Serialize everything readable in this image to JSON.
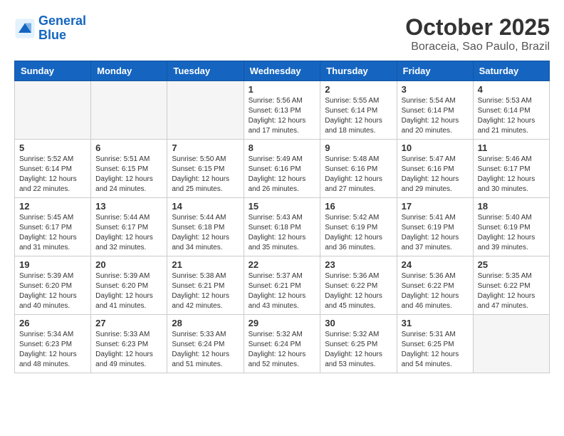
{
  "header": {
    "logo_line1": "General",
    "logo_line2": "Blue",
    "month_year": "October 2025",
    "location": "Boraceia, Sao Paulo, Brazil"
  },
  "weekdays": [
    "Sunday",
    "Monday",
    "Tuesday",
    "Wednesday",
    "Thursday",
    "Friday",
    "Saturday"
  ],
  "weeks": [
    [
      {
        "day": "",
        "empty": true
      },
      {
        "day": "",
        "empty": true
      },
      {
        "day": "",
        "empty": true
      },
      {
        "day": "1",
        "sunrise": "5:56 AM",
        "sunset": "6:13 PM",
        "daylight": "12 hours and 17 minutes."
      },
      {
        "day": "2",
        "sunrise": "5:55 AM",
        "sunset": "6:14 PM",
        "daylight": "12 hours and 18 minutes."
      },
      {
        "day": "3",
        "sunrise": "5:54 AM",
        "sunset": "6:14 PM",
        "daylight": "12 hours and 20 minutes."
      },
      {
        "day": "4",
        "sunrise": "5:53 AM",
        "sunset": "6:14 PM",
        "daylight": "12 hours and 21 minutes."
      }
    ],
    [
      {
        "day": "5",
        "sunrise": "5:52 AM",
        "sunset": "6:14 PM",
        "daylight": "12 hours and 22 minutes."
      },
      {
        "day": "6",
        "sunrise": "5:51 AM",
        "sunset": "6:15 PM",
        "daylight": "12 hours and 24 minutes."
      },
      {
        "day": "7",
        "sunrise": "5:50 AM",
        "sunset": "6:15 PM",
        "daylight": "12 hours and 25 minutes."
      },
      {
        "day": "8",
        "sunrise": "5:49 AM",
        "sunset": "6:16 PM",
        "daylight": "12 hours and 26 minutes."
      },
      {
        "day": "9",
        "sunrise": "5:48 AM",
        "sunset": "6:16 PM",
        "daylight": "12 hours and 27 minutes."
      },
      {
        "day": "10",
        "sunrise": "5:47 AM",
        "sunset": "6:16 PM",
        "daylight": "12 hours and 29 minutes."
      },
      {
        "day": "11",
        "sunrise": "5:46 AM",
        "sunset": "6:17 PM",
        "daylight": "12 hours and 30 minutes."
      }
    ],
    [
      {
        "day": "12",
        "sunrise": "5:45 AM",
        "sunset": "6:17 PM",
        "daylight": "12 hours and 31 minutes."
      },
      {
        "day": "13",
        "sunrise": "5:44 AM",
        "sunset": "6:17 PM",
        "daylight": "12 hours and 32 minutes."
      },
      {
        "day": "14",
        "sunrise": "5:44 AM",
        "sunset": "6:18 PM",
        "daylight": "12 hours and 34 minutes."
      },
      {
        "day": "15",
        "sunrise": "5:43 AM",
        "sunset": "6:18 PM",
        "daylight": "12 hours and 35 minutes."
      },
      {
        "day": "16",
        "sunrise": "5:42 AM",
        "sunset": "6:19 PM",
        "daylight": "12 hours and 36 minutes."
      },
      {
        "day": "17",
        "sunrise": "5:41 AM",
        "sunset": "6:19 PM",
        "daylight": "12 hours and 37 minutes."
      },
      {
        "day": "18",
        "sunrise": "5:40 AM",
        "sunset": "6:19 PM",
        "daylight": "12 hours and 39 minutes."
      }
    ],
    [
      {
        "day": "19",
        "sunrise": "5:39 AM",
        "sunset": "6:20 PM",
        "daylight": "12 hours and 40 minutes."
      },
      {
        "day": "20",
        "sunrise": "5:39 AM",
        "sunset": "6:20 PM",
        "daylight": "12 hours and 41 minutes."
      },
      {
        "day": "21",
        "sunrise": "5:38 AM",
        "sunset": "6:21 PM",
        "daylight": "12 hours and 42 minutes."
      },
      {
        "day": "22",
        "sunrise": "5:37 AM",
        "sunset": "6:21 PM",
        "daylight": "12 hours and 43 minutes."
      },
      {
        "day": "23",
        "sunrise": "5:36 AM",
        "sunset": "6:22 PM",
        "daylight": "12 hours and 45 minutes."
      },
      {
        "day": "24",
        "sunrise": "5:36 AM",
        "sunset": "6:22 PM",
        "daylight": "12 hours and 46 minutes."
      },
      {
        "day": "25",
        "sunrise": "5:35 AM",
        "sunset": "6:22 PM",
        "daylight": "12 hours and 47 minutes."
      }
    ],
    [
      {
        "day": "26",
        "sunrise": "5:34 AM",
        "sunset": "6:23 PM",
        "daylight": "12 hours and 48 minutes."
      },
      {
        "day": "27",
        "sunrise": "5:33 AM",
        "sunset": "6:23 PM",
        "daylight": "12 hours and 49 minutes."
      },
      {
        "day": "28",
        "sunrise": "5:33 AM",
        "sunset": "6:24 PM",
        "daylight": "12 hours and 51 minutes."
      },
      {
        "day": "29",
        "sunrise": "5:32 AM",
        "sunset": "6:24 PM",
        "daylight": "12 hours and 52 minutes."
      },
      {
        "day": "30",
        "sunrise": "5:32 AM",
        "sunset": "6:25 PM",
        "daylight": "12 hours and 53 minutes."
      },
      {
        "day": "31",
        "sunrise": "5:31 AM",
        "sunset": "6:25 PM",
        "daylight": "12 hours and 54 minutes."
      },
      {
        "day": "",
        "empty": true
      }
    ]
  ]
}
